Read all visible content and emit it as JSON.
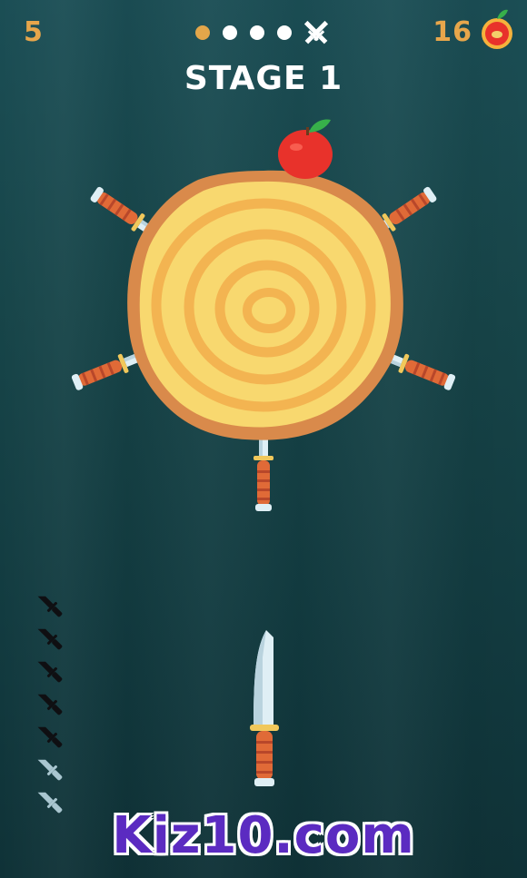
{
  "hud": {
    "score": "5",
    "apple_count": "16",
    "stage_title": "STAGE 1",
    "stage_progress": {
      "total_stages": 4,
      "current_stage": 1,
      "boss_icon": "crossed-swords-icon"
    }
  },
  "knives_remaining": {
    "total": 7,
    "used": 5,
    "remaining": 2
  },
  "target": {
    "stuck_knives": 5,
    "apple_on_log": true
  },
  "brand": {
    "text": "Kiz10.com"
  },
  "colors": {
    "accent": "#e7a64b",
    "log_wood": "#f8d86f",
    "log_bark": "#d88a4a",
    "knife_handle": "#e06a37",
    "apple": "#e8322b",
    "brand": "#5b2bc1"
  }
}
